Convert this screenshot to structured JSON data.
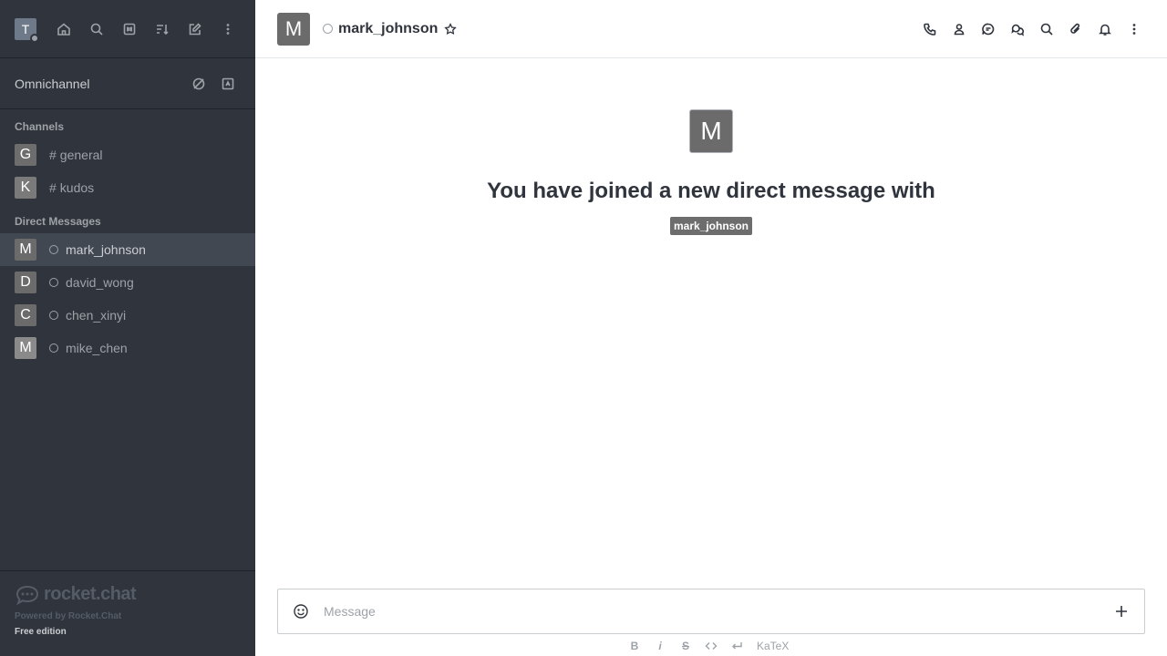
{
  "user": {
    "avatar_letter": "T"
  },
  "sidebar": {
    "omnichannel_label": "Omnichannel",
    "channels_title": "Channels",
    "channels": [
      {
        "letter": "G",
        "name": "general",
        "color": "#6d6d6d"
      },
      {
        "letter": "K",
        "name": "kudos",
        "color": "#7a7a7a"
      }
    ],
    "dm_title": "Direct Messages",
    "direct_messages": [
      {
        "letter": "M",
        "name": "mark_johnson",
        "color": "#6b6b6b",
        "active": true
      },
      {
        "letter": "D",
        "name": "david_wong",
        "color": "#6b6b6b"
      },
      {
        "letter": "C",
        "name": "chen_xinyi",
        "color": "#6b6b6b"
      },
      {
        "letter": "M",
        "name": "mike_chen",
        "color": "#8a8a8a"
      }
    ],
    "footer": {
      "logo_text": "rocket.chat",
      "powered_by": "Powered by Rocket.Chat",
      "edition": "Free edition"
    }
  },
  "header": {
    "avatar_letter": "M",
    "room_name": "mark_johnson"
  },
  "welcome": {
    "avatar_letter": "M",
    "text": "You have joined a new direct message with",
    "mention": "mark_johnson"
  },
  "composer": {
    "placeholder": "Message",
    "format": {
      "bold": "B",
      "italic": "i",
      "strike": "S",
      "katex": "KaTeX"
    }
  },
  "colors": {
    "sidebar_bg": "#2f343d",
    "main_bg": "#ffffff",
    "text": "#2f343d"
  }
}
